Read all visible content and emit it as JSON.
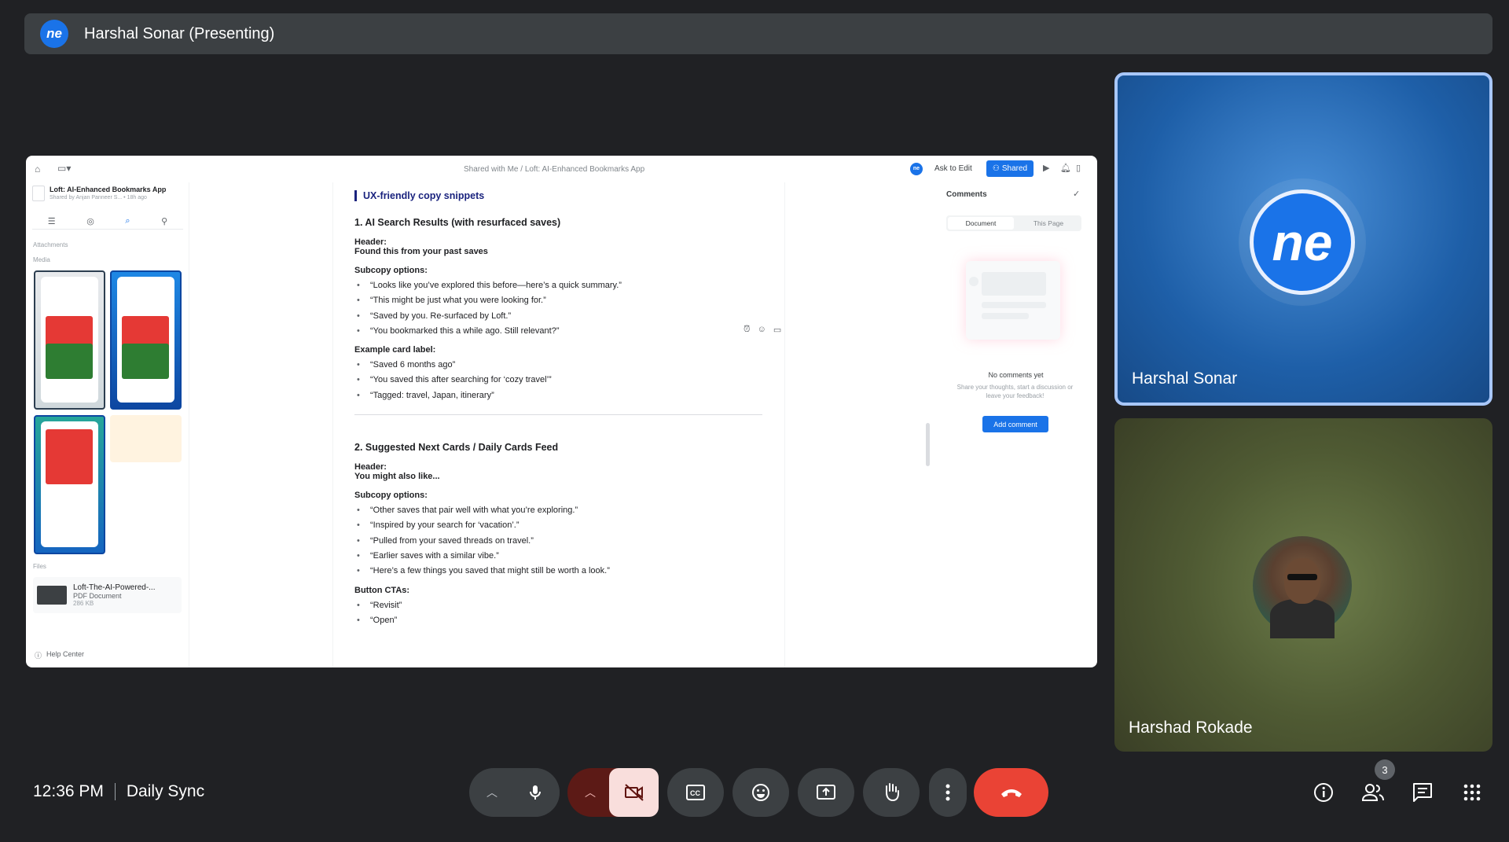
{
  "meeting": {
    "presenter_banner": "Harshal Sonar (Presenting)",
    "time": "12:36 PM",
    "name": "Daily Sync",
    "participant_count": "3"
  },
  "shared_doc": {
    "breadcrumb": "Shared with Me  /  Loft: AI-Enhanced Bookmarks App",
    "ask_to_edit": "Ask to Edit",
    "shared_label": "Shared",
    "doc_title": "Loft: AI-Enhanced Bookmarks App",
    "doc_meta": "Shared by Anjan Panneer S...   • 18h ago",
    "sections": {
      "attachments": "Attachments",
      "media": "Media",
      "files": "Files"
    },
    "file": {
      "name": "Loft-The-AI-Powered-...",
      "type": "PDF Document",
      "size": "286 KB"
    },
    "help": "Help Center",
    "content": {
      "heading": "UX-friendly copy snippets",
      "s1_title": "1. AI Search Results (with resurfaced saves)",
      "header_label": "Header:",
      "s1_header": "Found this from your past saves",
      "subcopy_label": "Subcopy options:",
      "s1_subcopy": [
        "“Looks like you’ve explored this before—here’s a quick summary.”",
        "“This might be just what you were looking for.”",
        "“Saved by you. Re-surfaced by Loft.”",
        "“You bookmarked this a while ago. Still relevant?”"
      ],
      "card_label": "Example card label:",
      "s1_cards": [
        "“Saved 6 months ago”",
        "“You saved this after searching for ‘cozy travel’”",
        "“Tagged: travel, Japan, itinerary”"
      ],
      "s2_title": "2. Suggested Next Cards / Daily Cards Feed",
      "s2_header": "You might also like...",
      "s2_subcopy": [
        "“Other saves that pair well with what you’re exploring.”",
        "“Inspired by your search for ‘vacation’.”",
        "“Pulled from your saved threads on travel.”",
        "“Earlier saves with a similar vibe.”",
        "“Here’s a few things you saved that might still be worth a look.”"
      ],
      "cta_label": "Button CTAs:",
      "s2_ctas": [
        "“Revisit”",
        "“Open”"
      ]
    },
    "comments": {
      "title": "Comments",
      "tab_document": "Document",
      "tab_page": "This Page",
      "empty_title": "No comments yet",
      "empty_hint": "Share your thoughts, start a discussion or leave your feedback!",
      "add_button": "Add comment"
    }
  },
  "participants": [
    {
      "name": "Harshal Sonar",
      "avatar": "ne"
    },
    {
      "name": "Harshad Rokade"
    }
  ],
  "colors": {
    "accent": "#1a73e8",
    "end_call": "#ea4335",
    "camera_off_bg": "#f9dedc"
  }
}
